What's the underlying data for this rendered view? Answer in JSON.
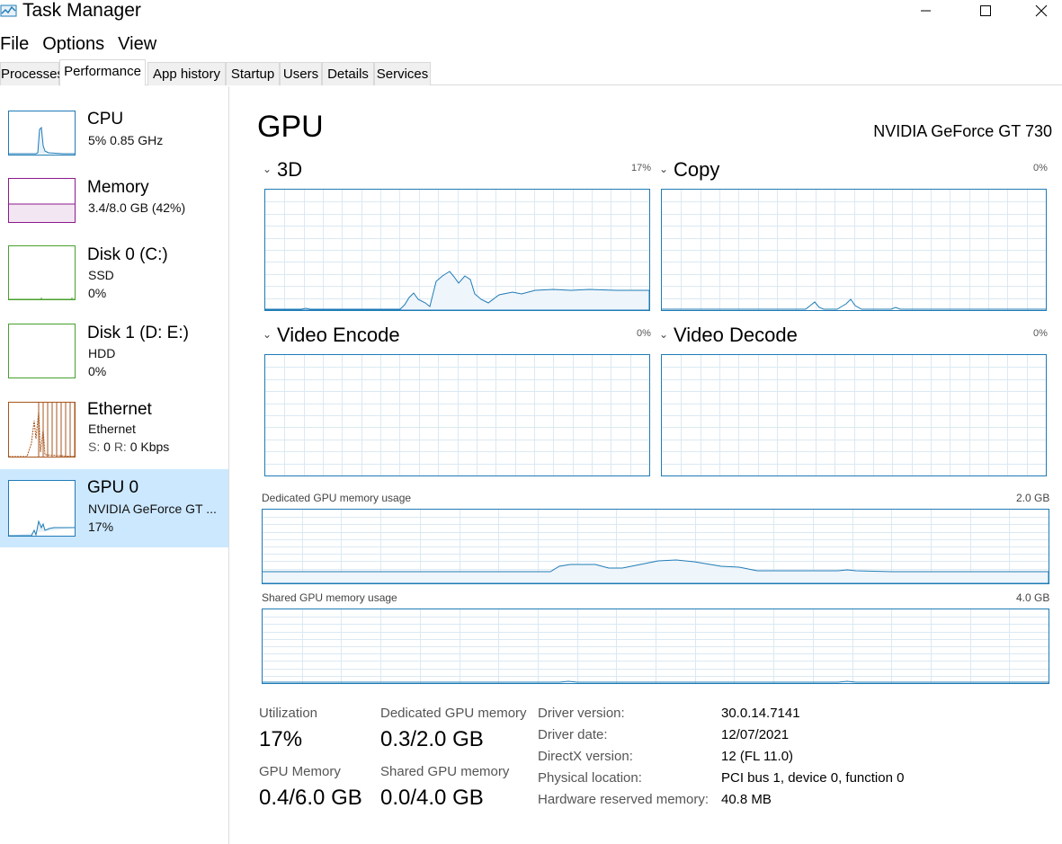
{
  "window": {
    "title": "Task Manager",
    "minimize_icon": "minimize-icon",
    "maximize_icon": "maximize-icon",
    "close_icon": "close-icon"
  },
  "menu": [
    "File",
    "Options",
    "View"
  ],
  "tabs": [
    "Processes",
    "Performance",
    "App history",
    "Startup",
    "Users",
    "Details",
    "Services"
  ],
  "active_tab": "Performance",
  "sidebar": [
    {
      "title": "CPU",
      "sub1": "5%  0.85 GHz",
      "sub2": "",
      "color": "#1f7bb6"
    },
    {
      "title": "Memory",
      "sub1": "3.4/8.0 GB (42%)",
      "sub2": "",
      "color": "#8b1a8b"
    },
    {
      "title": "Disk 0 (C:)",
      "sub1": "SSD",
      "sub2": "0%",
      "color": "#4aa02c"
    },
    {
      "title": "Disk 1 (D: E:)",
      "sub1": "HDD",
      "sub2": "0%",
      "color": "#4aa02c"
    },
    {
      "title": "Ethernet",
      "sub1": "Ethernet",
      "sub2_s_label": "S:",
      "sub2_s_value": "0",
      "sub2_r_label": "R:",
      "sub2_r_value": "0 Kbps",
      "color": "#a7541c"
    },
    {
      "title": "GPU 0",
      "sub1": "NVIDIA GeForce GT ...",
      "sub2": "17%",
      "color": "#1f7bb6"
    }
  ],
  "main": {
    "title": "GPU",
    "model": "NVIDIA GeForce GT 730",
    "engines": [
      {
        "label": "3D",
        "pct": "17%"
      },
      {
        "label": "Copy",
        "pct": "0%"
      },
      {
        "label": "Video Encode",
        "pct": "0%"
      },
      {
        "label": "Video Decode",
        "pct": "0%"
      }
    ],
    "dedicated_label": "Dedicated GPU memory usage",
    "dedicated_max": "2.0 GB",
    "shared_label": "Shared GPU memory usage",
    "shared_max": "4.0 GB"
  },
  "stats": {
    "utilization_label": "Utilization",
    "utilization_value": "17%",
    "dedicated_label": "Dedicated GPU memory",
    "dedicated_value": "0.3/2.0 GB",
    "gpumem_label": "GPU Memory",
    "gpumem_value": "0.4/6.0 GB",
    "shared_label": "Shared GPU memory",
    "shared_value": "0.0/4.0 GB"
  },
  "info": [
    {
      "label": "Driver version:",
      "value": "30.0.14.7141"
    },
    {
      "label": "Driver date:",
      "value": "12/07/2021"
    },
    {
      "label": "DirectX version:",
      "value": "12 (FL 11.0)"
    },
    {
      "label": "Physical location:",
      "value": "PCI bus 1, device 0, function 0"
    },
    {
      "label": "Hardware reserved memory:",
      "value": "40.8 MB"
    }
  ],
  "accent_color": "#1f7bb6",
  "selected_bg": "#cce8ff"
}
